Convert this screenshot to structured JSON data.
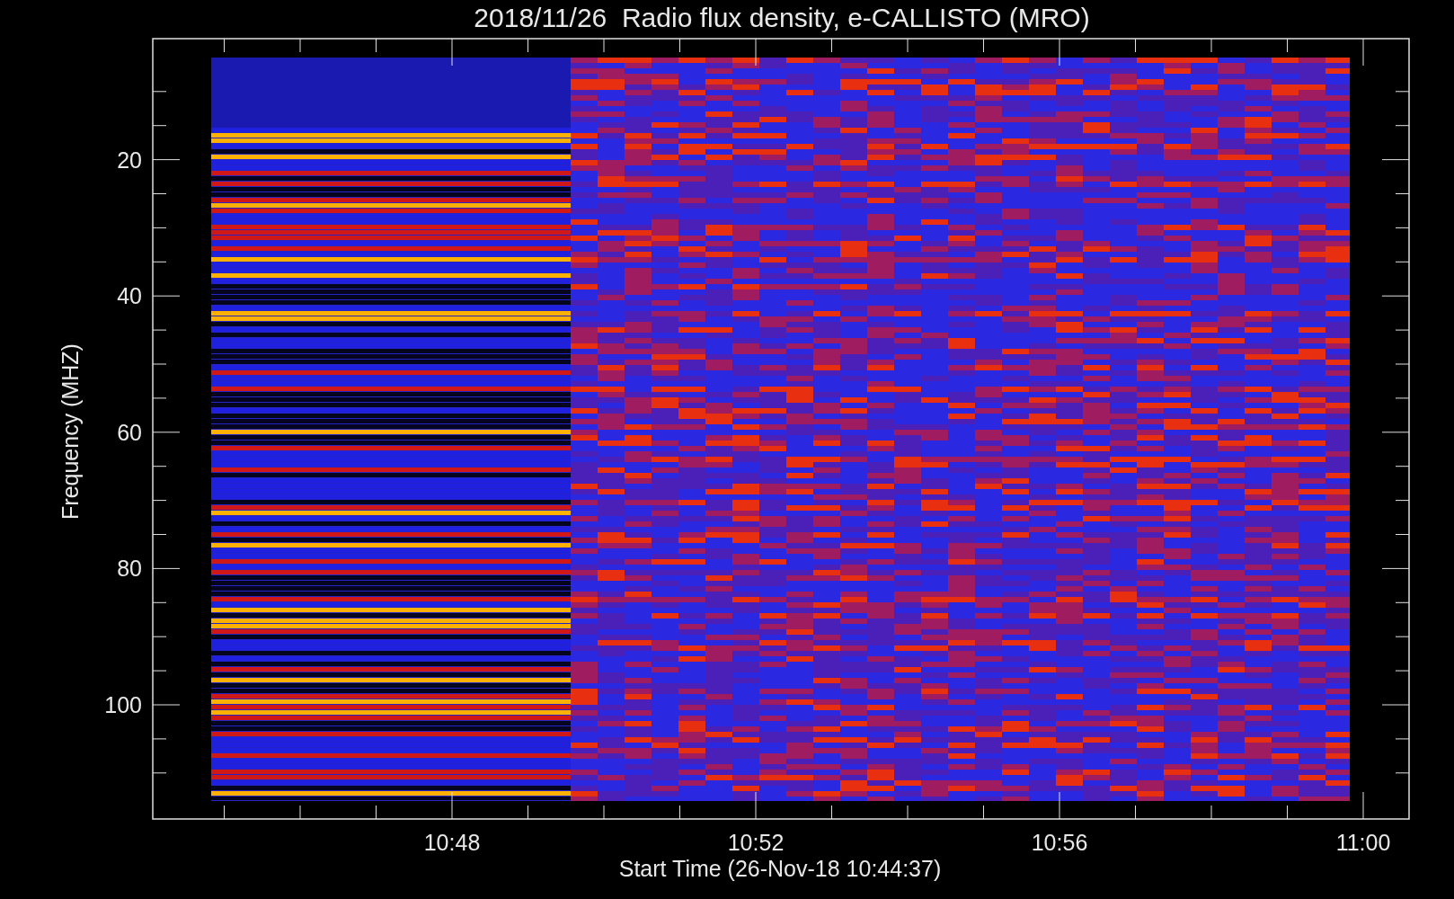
{
  "chart": {
    "title": "2018/11/26  Radio flux density, e-CALLISTO (MRO)",
    "xlabel": "Start Time (26-Nov-18 10:44:37)",
    "ylabel": "Frequency (MHZ)",
    "yticks": [
      "20",
      "40",
      "60",
      "80",
      "100"
    ],
    "xticks": [
      "10:48",
      "10:52",
      "10:56",
      "11:00"
    ]
  }
}
